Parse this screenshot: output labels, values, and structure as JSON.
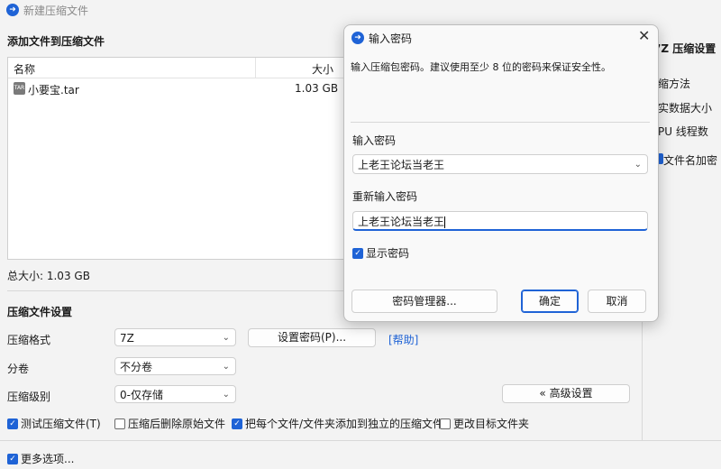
{
  "window": {
    "title": "新建压缩文件"
  },
  "files": {
    "section_title": "添加文件到压缩文件",
    "columns": {
      "name": "名称",
      "size": "大小"
    },
    "rows": [
      {
        "name": "小要宝.tar",
        "size": "1.03 GB",
        "icon": "tar-file-icon"
      }
    ],
    "total": "总大小: 1.03 GB"
  },
  "right_panel": {
    "title": "7Z 压缩设置",
    "items": [
      "缩方法",
      "实数据大小",
      "PU 线程数"
    ],
    "encrypt_names": "文件名加密"
  },
  "settings": {
    "section_title": "压缩文件设置",
    "format_label": "压缩格式",
    "format_value": "7Z",
    "set_password": "设置密码(P)...",
    "help": "[帮助]",
    "split_label": "分卷",
    "split_value": "不分卷",
    "level_label": "压缩级别",
    "level_value": "0-仅存储",
    "advanced": "« 高级设置",
    "options": [
      {
        "label": "测试压缩文件(T)",
        "checked": true
      },
      {
        "label": "压缩后删除原始文件",
        "checked": false
      },
      {
        "label": "把每个文件/文件夹添加到独立的压缩文件",
        "checked": true
      },
      {
        "label": "更改目标文件夹",
        "checked": false
      }
    ],
    "more": {
      "label": "更多选项...",
      "checked": true
    }
  },
  "dialog": {
    "title": "输入密码",
    "description": "输入压缩包密码。建议使用至少 8 位的密码来保证安全性。",
    "password_label": "输入密码",
    "password_value": "上老王论坛当老王",
    "confirm_label": "重新输入密码",
    "confirm_value": "上老王论坛当老王",
    "show_password": {
      "label": "显示密码",
      "checked": true
    },
    "manager_button": "密码管理器...",
    "ok_button": "确定",
    "cancel_button": "取消"
  },
  "colors": {
    "accent": "#1f63d6",
    "link": "#1f63d6"
  }
}
